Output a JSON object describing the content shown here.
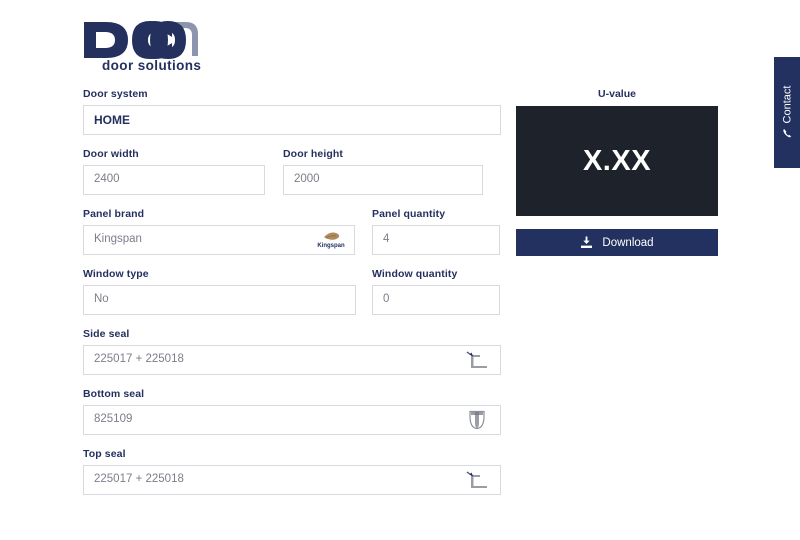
{
  "brand": {
    "name": "DOCO",
    "tagline": "door solutions",
    "logo_dark": "#24305e",
    "logo_arc": "#8d94ad"
  },
  "colors": {
    "navy": "#22315f",
    "label_navy": "#24305e",
    "value_gray": "#7c7f8a",
    "border": "#d8dade",
    "uvalue_bg": "#1e222a",
    "kingspan_swoosh": "#b08a5e"
  },
  "form": {
    "door_system": {
      "label": "Door system",
      "value": "HOME",
      "icon": ""
    },
    "door_width": {
      "label": "Door width",
      "value": "2400"
    },
    "door_height": {
      "label": "Door height",
      "value": "2000"
    },
    "panel_brand": {
      "label": "Panel brand",
      "value": "Kingspan",
      "icon": "kingspan-logo-icon",
      "icon_text": "Kingspan"
    },
    "panel_quantity": {
      "label": "Panel quantity",
      "value": "4"
    },
    "window_type": {
      "label": "Window type",
      "value": "No"
    },
    "window_quantity": {
      "label": "Window quantity",
      "value": "0"
    },
    "side_seal": {
      "label": "Side seal",
      "value": "225017 + 225018",
      "icon": "seal-profile-corner-icon"
    },
    "bottom_seal": {
      "label": "Bottom seal",
      "value": "825109",
      "icon": "seal-profile-bulb-icon"
    },
    "top_seal": {
      "label": "Top seal",
      "value": "225017 + 225018",
      "icon": "seal-profile-corner-icon"
    }
  },
  "result": {
    "uvalue_label": "U-value",
    "uvalue": "X.XX",
    "download_label": "Download",
    "download_icon": "download-icon"
  },
  "contact": {
    "label": "Contact",
    "icon": "phone-icon"
  }
}
